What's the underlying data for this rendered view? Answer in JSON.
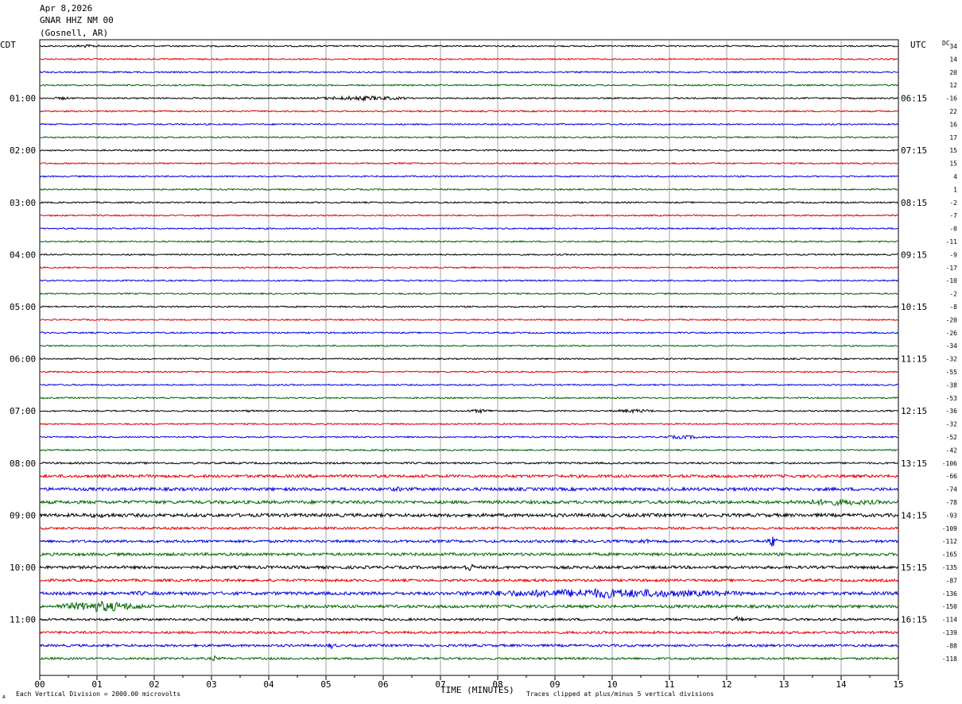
{
  "header": {
    "date": "Apr 8,2026",
    "station": "GNAR HHZ NM 00",
    "location": "(Gosnell, AR)"
  },
  "left_timezone": "CDT",
  "right_timezone": "UTC",
  "dc_label": "DC",
  "footer": {
    "scale_note": "Each Vertical Division = 2000.00 microvolts",
    "clip_note": "Traces clipped at plus/minus 5 vertical divisions",
    "corner_mark": "A"
  },
  "colors": {
    "trace_cycle": [
      "#000000",
      "#e00000",
      "#0000e0",
      "#006400"
    ],
    "grid": "#a0a0a0",
    "frame": "#000000"
  },
  "chart_data": {
    "type": "line",
    "subtype": "helicorder",
    "xlabel": "TIME (MINUTES)",
    "xlim": [
      0,
      15
    ],
    "x_ticks": [
      "00",
      "01",
      "02",
      "03",
      "04",
      "05",
      "06",
      "07",
      "08",
      "09",
      "10",
      "11",
      "12",
      "13",
      "14",
      "15"
    ],
    "rows": 48,
    "minutes_per_row": 15,
    "left_hour_labels": [
      "01:00",
      "02:00",
      "03:00",
      "04:00",
      "05:00",
      "06:00",
      "07:00",
      "08:00",
      "09:00",
      "10:00",
      "11:00"
    ],
    "right_hour_labels": [
      "06:15",
      "07:15",
      "08:15",
      "09:15",
      "10:15",
      "11:15",
      "12:15",
      "13:15",
      "14:15",
      "15:15",
      "16:15"
    ],
    "hour_label_first_row": 4,
    "hour_label_every": 4,
    "dc_offsets": [
      "34",
      "14",
      "20",
      "12",
      "-16",
      "22",
      "16",
      "17",
      "15",
      "15",
      "4",
      "1",
      "-2",
      "-7",
      "-0",
      "-11",
      "-9",
      "-17",
      "-10",
      "-2",
      "-8",
      "-20",
      "-26",
      "-34",
      "-32",
      "-55",
      "-38",
      "-53",
      "-36",
      "-32",
      "-52",
      "-42",
      "-106",
      "-66",
      "-74",
      "-78",
      "-93",
      "-109",
      "-112",
      "-165",
      "-135",
      "-87",
      "-136",
      "-150",
      "-114",
      "-139",
      "-88",
      "-118"
    ],
    "noise_level_per_row": [
      1,
      1,
      1,
      1,
      1,
      1,
      1,
      1,
      1,
      1,
      1,
      1,
      1,
      1,
      1,
      1,
      1,
      1,
      1,
      1,
      1,
      1,
      1,
      1,
      1,
      1,
      1,
      1,
      1,
      1,
      1,
      1,
      1.3,
      2,
      2.2,
      2.2,
      2.3,
      1.6,
      1.8,
      2,
      2,
      1.8,
      2.2,
      2,
      1.6,
      1.7,
      1.7,
      1.5
    ],
    "events": [
      {
        "row": 0,
        "start": 0.4,
        "end": 1.2,
        "amp": 2
      },
      {
        "row": 4,
        "start": 0.2,
        "end": 0.6,
        "amp": 2
      },
      {
        "row": 4,
        "start": 4.8,
        "end": 6.5,
        "amp": 3
      },
      {
        "row": 28,
        "start": 3.4,
        "end": 3.9,
        "amp": 1.5
      },
      {
        "row": 28,
        "start": 7.4,
        "end": 8.0,
        "amp": 2.5
      },
      {
        "row": 28,
        "start": 10.0,
        "end": 10.8,
        "amp": 2.5
      },
      {
        "row": 30,
        "start": 10.8,
        "end": 11.7,
        "amp": 2.5
      },
      {
        "row": 31,
        "start": 5.6,
        "end": 6.5,
        "amp": 1.5
      },
      {
        "row": 34,
        "start": 6.0,
        "end": 6.5,
        "amp": 3
      },
      {
        "row": 35,
        "start": 12.8,
        "end": 15.0,
        "amp": 4
      },
      {
        "row": 36,
        "start": 0.4,
        "end": 1.8,
        "amp": 3
      },
      {
        "row": 38,
        "start": 12.7,
        "end": 12.9,
        "amp": 8
      },
      {
        "row": 38,
        "start": 10.2,
        "end": 10.9,
        "amp": 3
      },
      {
        "row": 40,
        "start": 7.4,
        "end": 7.6,
        "amp": 6
      },
      {
        "row": 42,
        "start": 7.3,
        "end": 12.4,
        "amp": 6
      },
      {
        "row": 42,
        "start": 1.5,
        "end": 2.0,
        "amp": 3
      },
      {
        "row": 43,
        "start": 0.3,
        "end": 1.8,
        "amp": 7
      },
      {
        "row": 44,
        "start": 12.1,
        "end": 12.3,
        "amp": 5
      },
      {
        "row": 46,
        "start": 5.0,
        "end": 5.2,
        "amp": 4
      },
      {
        "row": 47,
        "start": 3.0,
        "end": 3.1,
        "amp": 4
      }
    ]
  }
}
